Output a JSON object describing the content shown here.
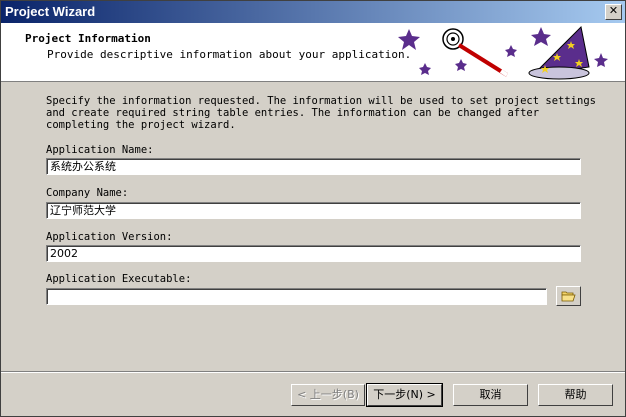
{
  "window": {
    "title": "Project Wizard",
    "close_label": "✕"
  },
  "header": {
    "title": "Project Information",
    "subtitle": "Provide descriptive information about your application."
  },
  "intro": {
    "lines": [
      "Specify the information requested.  The information will be used to set project settings",
      "and create required string table entries.  The information can be changed after",
      "completing the project wizard."
    ]
  },
  "fields": {
    "app_name": {
      "label": "Application Name:",
      "value": "系统办公系统"
    },
    "company": {
      "label": "Company Name:",
      "value": "辽宁师范大学"
    },
    "version": {
      "label": "Application Version:",
      "value": "2002"
    },
    "executable": {
      "label": "Application Executable:",
      "value": ""
    }
  },
  "buttons": {
    "back": "< 上一步(B)",
    "next": "下一步(N) >",
    "cancel": "取消",
    "help": "帮助"
  },
  "icons": {
    "browse": "folder-open-icon"
  },
  "colors": {
    "star": "#5a2d8c",
    "title_bar": "#0a246a",
    "wand": "#c00000"
  }
}
